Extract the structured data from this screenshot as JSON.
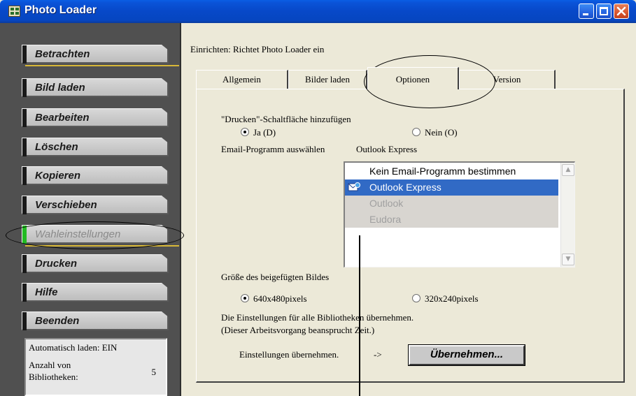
{
  "window": {
    "title": "Photo Loader",
    "controls": {
      "minimize": "_",
      "maximize": "□",
      "close": "X"
    }
  },
  "sidebar": {
    "items": [
      {
        "label": "Betrachten",
        "active": false
      },
      {
        "label": "Bild laden",
        "active": false
      },
      {
        "label": "Bearbeiten",
        "active": false
      },
      {
        "label": "Löschen",
        "active": false
      },
      {
        "label": "Kopieren",
        "active": false
      },
      {
        "label": "Verschieben",
        "active": false
      },
      {
        "label": "Wahleinstellungen",
        "active": true
      },
      {
        "label": "Drucken",
        "active": false
      },
      {
        "label": "Hilfe",
        "active": false
      },
      {
        "label": "Beenden",
        "active": false
      }
    ],
    "status": {
      "autoload": "Automatisch laden: EIN",
      "libraries_label": "Anzahl von Bibliotheken:",
      "libraries_value": "5"
    }
  },
  "main": {
    "caption": "Einrichten: Richtet Photo Loader ein",
    "tabs": [
      {
        "label": "Allgemein"
      },
      {
        "label": "Bilder laden"
      },
      {
        "label": "Optionen"
      },
      {
        "label": "Version"
      }
    ],
    "selected_tab": "Optionen",
    "print_button": {
      "label": "\"Drucken\"-Schaltfläche hinzufügen",
      "yes": "Ja (D)",
      "no": "Nein (O)",
      "selected": "yes"
    },
    "email": {
      "label": "Email-Programm auswählen",
      "current": "Outlook Express",
      "options": [
        {
          "label": "Kein Email-Programm bestimmen",
          "state": "normal",
          "icon": ""
        },
        {
          "label": "Outlook Express",
          "state": "selected",
          "icon": "outlook-express-icon"
        },
        {
          "label": "Outlook",
          "state": "disabled",
          "icon": ""
        },
        {
          "label": "Eudora",
          "state": "disabled",
          "icon": ""
        }
      ]
    },
    "image_size": {
      "label": "Größe des beigefügten Bildes",
      "option1": "640x480pixels",
      "option2": "320x240pixels",
      "selected": "640x480pixels"
    },
    "apply": {
      "line1": "Die Einstellungen für alle Bibliotheken übernehmen.",
      "line2": "(Dieser Arbeitsvorgang beansprucht Zeit.)",
      "label": "Einstellungen übernehmen.",
      "arrow": "->",
      "button": "Übernehmen..."
    }
  },
  "colors": {
    "titlebar": "#0748c8",
    "sidebar": "#505050",
    "selection": "#316ac5",
    "active_marker": "#22bb22",
    "separator": "#d8b838"
  }
}
